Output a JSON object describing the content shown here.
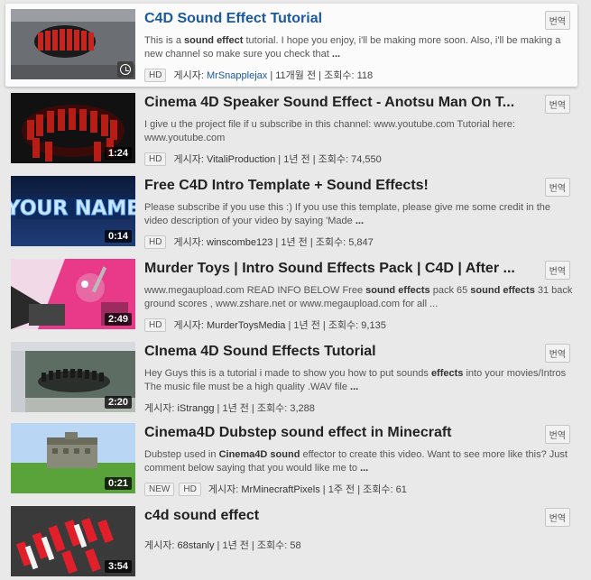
{
  "translate_label": "번역",
  "hd_label": "HD",
  "new_label": "NEW",
  "author_prefix": "게시자:",
  "views_prefix": "조회수:",
  "results": [
    {
      "title": "C4D Sound Effect Tutorial",
      "desc": [
        "This is a ",
        "sound effect",
        " tutorial. I hope you enjoy, i'll be making more soon. Also, i'll be making a new channel so make sure you check that ",
        "...",
        ""
      ],
      "author": "MrSnapplejax",
      "age": "11개월 전",
      "views": "118",
      "duration": "",
      "has_hd": true,
      "has_new": false
    },
    {
      "title": "Cinema 4D Speaker Sound Effect - Anotsu Man On T...",
      "desc": [
        "I give u the project file if u subscribe in this channel: www.youtube.com Tutorial here: www.youtube.com",
        "",
        "",
        "",
        ""
      ],
      "author": "VitaliProduction",
      "age": "1년 전",
      "views": "74,550",
      "duration": "1:24",
      "has_hd": true,
      "has_new": false
    },
    {
      "title": "Free C4D Intro Template + Sound Effects!",
      "desc": [
        "Please subscribe if you use this :) If you use this template, please give me some credit in the video description of your video by saying 'Made ",
        "...",
        "",
        "",
        ""
      ],
      "author": "winscombe123",
      "age": "1년 전",
      "views": "5,847",
      "duration": "0:14",
      "has_hd": true,
      "has_new": false
    },
    {
      "title": "Murder Toys | Intro Sound Effects Pack | C4D | After ...",
      "desc": [
        "www.megaupload.com READ INFO BELOW Free ",
        "sound effects",
        " pack 65 ",
        "sound effects",
        " 31 back ground scores , www.zshare.net or www.megaupload.com for all ..."
      ],
      "author": "MurderToysMedia",
      "age": "1년 전",
      "views": "9,135",
      "duration": "2:49",
      "has_hd": true,
      "has_new": false
    },
    {
      "title": "CInema 4D Sound Effects Tutorial",
      "desc": [
        "Hey Guys this is a tutorial i made to show you how to put sounds ",
        "effects",
        " into your movies/Intros The music file must be a high quality .WAV file ",
        "...",
        ""
      ],
      "author": "iStrangg",
      "age": "1년 전",
      "views": "3,288",
      "duration": "2:20",
      "has_hd": false,
      "has_new": false
    },
    {
      "title": "Cinema4D Dubstep sound effect in Minecraft",
      "desc": [
        "Dubstep used in ",
        "Cinema4D sound",
        " effector to create this video. Want to see more like this? Just comment below saying that you would like me to ",
        "...",
        ""
      ],
      "author": "MrMinecraftPixels",
      "age": "1주 전",
      "views": "61",
      "duration": "0:21",
      "has_hd": true,
      "has_new": true
    },
    {
      "title": "c4d sound effect",
      "desc": [
        "",
        "",
        "",
        "",
        ""
      ],
      "author": "68stanly",
      "age": "1년 전",
      "views": "58",
      "duration": "3:54",
      "has_hd": false,
      "has_new": false
    }
  ]
}
